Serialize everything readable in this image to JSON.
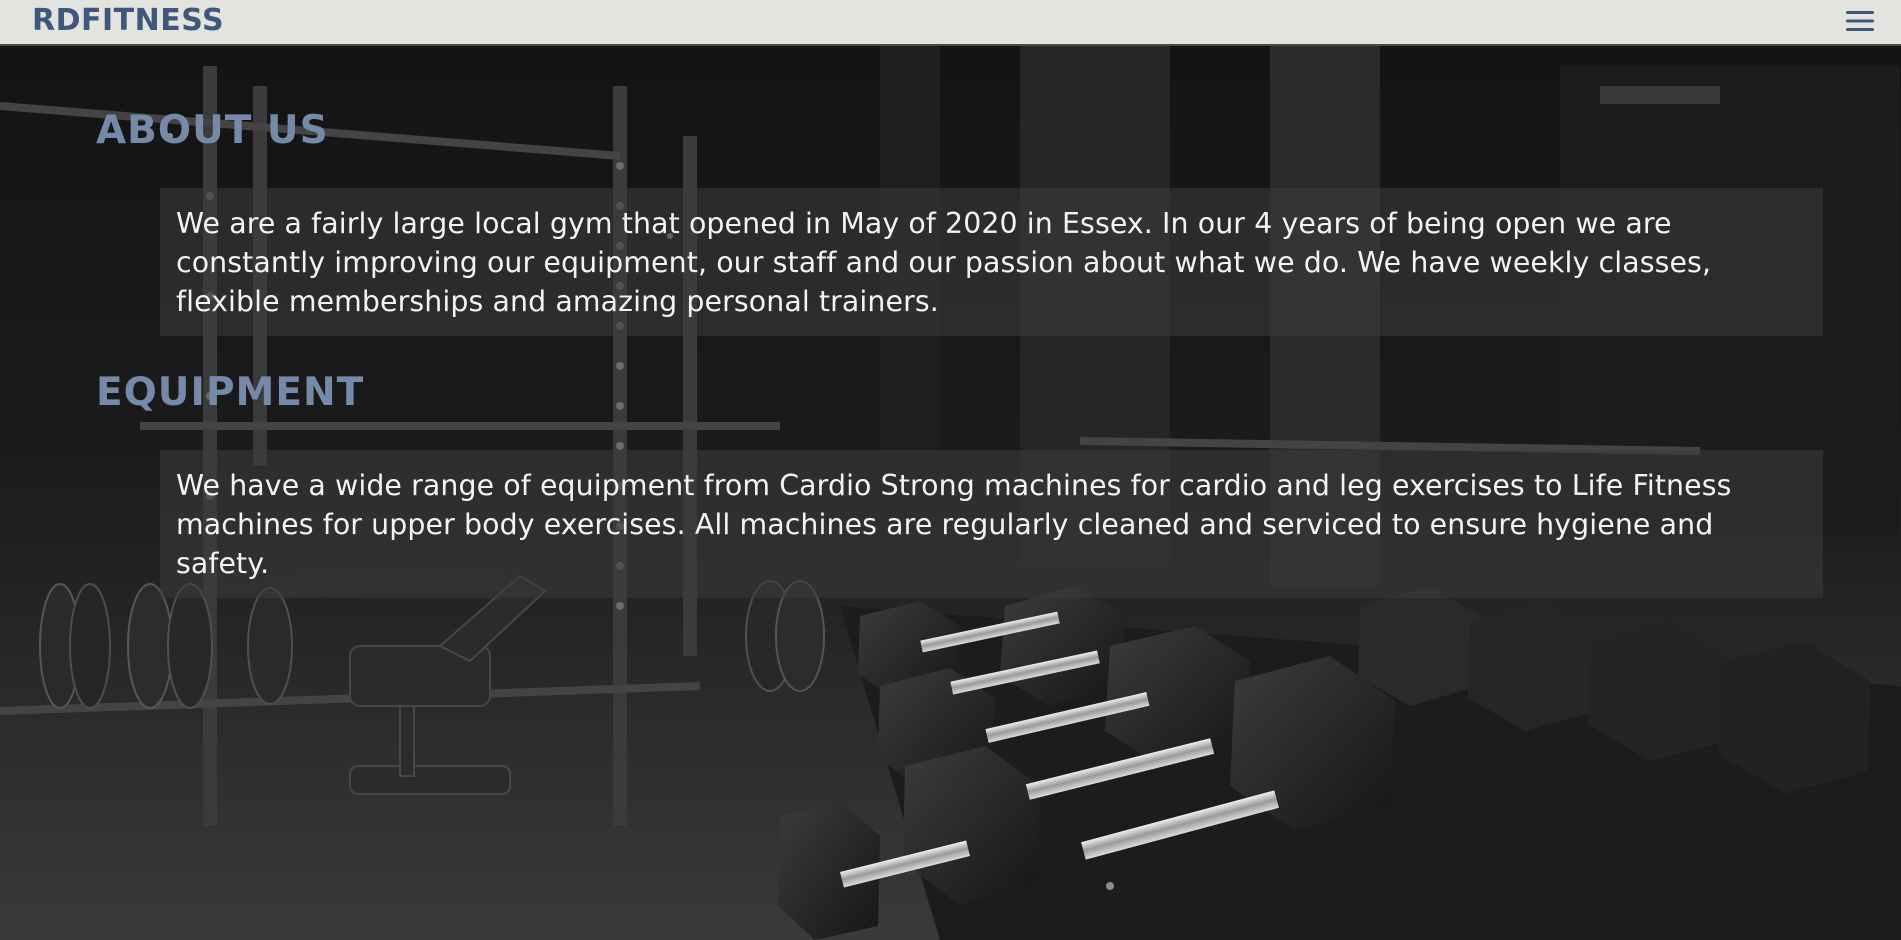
{
  "navbar": {
    "brand": "RDFITNESS",
    "menu_icon": "hamburger-menu-icon"
  },
  "sections": [
    {
      "heading": "ABOUT US",
      "body": "We are a fairly large local gym that opened in May of 2020 in Essex. In our 4 years of being open we are constantly improving our equipment, our staff and our passion about what we do. We have weekly classes, flexible memberships and amazing personal trainers."
    },
    {
      "heading": "EQUIPMENT",
      "body": "We have a wide range of equipment from Cardio Strong machines for cardio and leg exercises to Life Fitness machines for upper body exercises. All machines are regularly cleaned and serviced to ensure hygiene and safety."
    }
  ],
  "colors": {
    "navbar_bg": "#e3e4e0",
    "brand": "#3d5878",
    "heading": "#7589a8",
    "body_text": "#f3f3f3"
  }
}
